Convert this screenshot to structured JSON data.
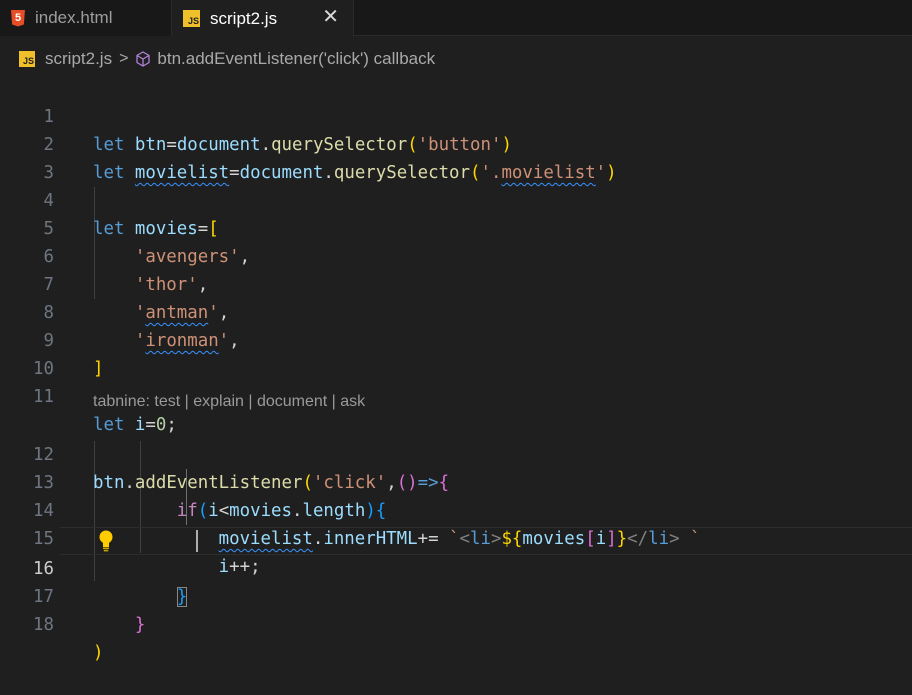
{
  "tabs": [
    {
      "label": "index.html",
      "icon": "html5-icon",
      "active": false
    },
    {
      "label": "script2.js",
      "icon": "js-file-icon",
      "active": true,
      "close": "✕"
    }
  ],
  "icon_labels": {
    "html": "5",
    "js": "JS"
  },
  "breadcrumb": {
    "file": "script2.js",
    "separator": ">",
    "symbol": "btn.addEventListener('click') callback"
  },
  "codelens": "tabnine: test | explain | document | ask",
  "line_numbers": [
    "1",
    "2",
    "3",
    "4",
    "5",
    "6",
    "7",
    "8",
    "9",
    "10",
    "11",
    "12",
    "13",
    "14",
    "15",
    "16",
    "17",
    "18"
  ],
  "code": {
    "l1": {
      "kw": "let",
      "v": "btn",
      "eq": "=",
      "obj": "document",
      "dot": ".",
      "fn": "querySelector",
      "open": "(",
      "str": "'button'",
      "close": ")"
    },
    "l2": {
      "kw": "let",
      "v": "movielist",
      "eq": "=",
      "obj": "document",
      "dot": ".",
      "fn": "querySelector",
      "open": "(",
      "q1": "'.",
      "sq": "movielist",
      "q2": "'",
      "close": ")"
    },
    "l4": {
      "kw": "let",
      "v": "movies",
      "eq": "=",
      "open": "["
    },
    "l5": {
      "str": "'avengers'",
      "comma": ","
    },
    "l6": {
      "str": "'thor'",
      "comma": ","
    },
    "l7": {
      "q1": "'",
      "sq": "antman",
      "q2": "'",
      "comma": ","
    },
    "l8": {
      "q1": "'",
      "sq": "ironman",
      "q2": "'",
      "comma": ","
    },
    "l9": {
      "close": "]"
    },
    "l11": {
      "kw": "let",
      "v": "i",
      "eq": "=",
      "num": "0",
      "semi": ";"
    },
    "l12": {
      "obj": "btn",
      "dot": ".",
      "fn": "addEventListener",
      "open": "(",
      "str": "'click'",
      "comma": ",",
      "p1": "()",
      "arrow": "=>",
      "brace": "{"
    },
    "l13": {
      "kw": "if",
      "open": "(",
      "v": "i",
      "lt": "<",
      "v2": "movies",
      "dot": ".",
      "prop": "length",
      "close": ")",
      "brace": "{"
    },
    "l14": {
      "sq": "movielist",
      "dot": ".",
      "prop": "innerHTML",
      "op": "+=",
      "bt": "`",
      "lt1": "<",
      "li1": "li",
      "gt1": ">",
      "ds": "${",
      "v": "movies",
      "ob": "[",
      "i": "i",
      "cb": "]",
      "ce": "}",
      "lt2": "</",
      "li2": "li",
      "gt2": ">",
      "sp": " ",
      "bt2": "`"
    },
    "l15": {
      "v": "i",
      "op": "++",
      "semi": ";"
    },
    "l16": {
      "brace": "}"
    },
    "l17": {
      "brace": "}"
    },
    "l18": {
      "close": ")"
    }
  },
  "colors": {
    "background": "#1f1f1f",
    "keyword": "#569cd6",
    "variable": "#9cdcfe",
    "function": "#dcdcaa",
    "string": "#ce9178",
    "number": "#b5cea8"
  }
}
